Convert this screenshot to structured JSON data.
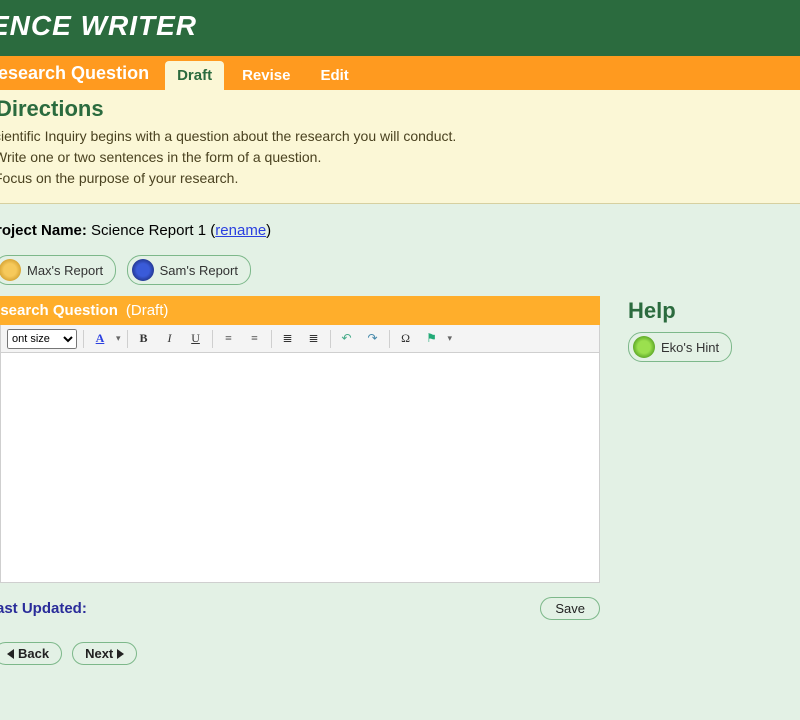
{
  "header": {
    "title": "ENCE WRITER"
  },
  "tabs": {
    "section": "esearch Question",
    "items": [
      "Draft",
      "Revise",
      "Edit"
    ],
    "active_index": 0
  },
  "directions": {
    "heading": "Directions",
    "line1": "cientific Inquiry begins with a question about the research you will conduct.",
    "line2": "Write one or two sentences in the form of a question.",
    "line3": "Focus on the purpose of your research."
  },
  "project": {
    "label_prefix": "roject Name:",
    "name": "Science Report 1",
    "rename_link": "rename"
  },
  "reports": [
    {
      "label": "Max's Report",
      "avatar": "max"
    },
    {
      "label": "Sam's Report",
      "avatar": "sam"
    }
  ],
  "editor": {
    "title": "esearch Question",
    "phase": "(Draft)",
    "font_size_label": "ont size"
  },
  "toolbar": {
    "font_color": "A",
    "bold": "B",
    "italic": "I",
    "underline": "U",
    "align_left": "≡",
    "align_center": "≡",
    "list_bullet": "≣",
    "list_number": "≣",
    "undo": "↶",
    "redo": "↷",
    "omega": "Ω",
    "flag": "⚑"
  },
  "help": {
    "heading": "Help",
    "hint_label": "Eko's Hint"
  },
  "footer": {
    "last_updated_label": "ast Updated:",
    "save_label": "Save"
  },
  "nav": {
    "back": "Back",
    "next": "Next"
  }
}
